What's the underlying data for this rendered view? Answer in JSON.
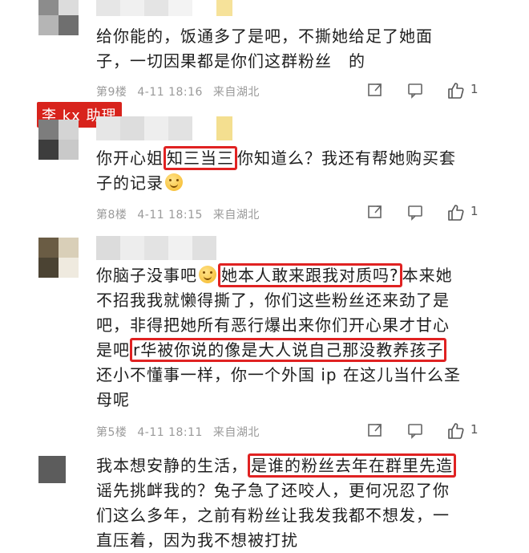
{
  "comments": [
    {
      "text_lines": [
        "给你能的，饭通多了是吧，不撕她给足了她面",
        "子，一切因果都是你们这群粉丝　的"
      ],
      "floor": "第9楼",
      "date": "4-11 18:16",
      "source": "来自湖北",
      "likes": "1"
    },
    {
      "badge": "李 kx 助理",
      "line1_pre": "你开心姐",
      "line1_hl": "知三当三",
      "line1_post": "你知道么？我还有帮她购买套",
      "line2": "子的记录",
      "floor": "第8楼",
      "date": "4-11 18:15",
      "source": "来自湖北",
      "likes": "1"
    },
    {
      "line1_pre": "你脑子没事吧",
      "line1_hl": "她本人敢来跟我对质吗?",
      "line1_post": "本来她",
      "line2": "不招我我就懒得撕了，你们这些粉丝还来劲了是",
      "line3": "吧，非得把她所有恶行爆出来你们开心果才甘心",
      "line4_pre": "是吧",
      "line4_hl": "r华被你说的像是大人说自己那没教养孩子",
      "line5": "还小不懂事一样，你一个外国 ip 在这儿当什么圣",
      "line6": "母呢",
      "floor": "第5楼",
      "date": "4-11 18:11",
      "source": "来自湖北",
      "likes": "1"
    },
    {
      "line1_pre": "我本想安静的生活，",
      "line1_hl": "是谁的粉丝去年在群里先造",
      "line2": "谣先挑衅我的？兔子急了还咬人，更何况忍了你",
      "line3": "们这么多年，之前有粉丝让我发我都不想发，一",
      "line4": "直压着，因为我不想被打扰"
    }
  ],
  "icons": {
    "share": "share-icon",
    "comment": "comment-icon",
    "like": "thumbs-up-icon"
  },
  "colors": {
    "highlight_border": "#e02222",
    "badge_bg": "#d8231c",
    "meta_text": "#9a9a9a"
  }
}
